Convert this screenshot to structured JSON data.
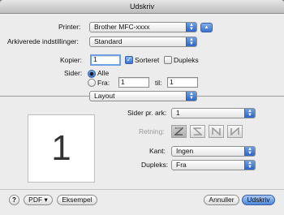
{
  "window": {
    "title": "Udskriv"
  },
  "printer": {
    "label": "Printer:",
    "value": "Brother MFC-xxxx"
  },
  "presets": {
    "label": "Arkiverede indstillinger:",
    "value": "Standard"
  },
  "copies": {
    "label": "Kopier:",
    "value": "1",
    "collated_label": "Sorteret",
    "collated_checked": true,
    "duplex_label": "Dupleks",
    "duplex_checked": false
  },
  "pages": {
    "label": "Sider:",
    "all_label": "Alle",
    "from_label": "Fra:",
    "from_value": "1",
    "to_label": "til:",
    "to_value": "1",
    "selected": "all"
  },
  "panel": {
    "value": "Layout"
  },
  "layout": {
    "preview_page": "1",
    "pages_per_sheet_label": "Sider pr. ark:",
    "pages_per_sheet_value": "1",
    "direction_label": "Retning:",
    "direction_icons": [
      "z-order-icon",
      "s-order-icon",
      "reverse-n-order-icon",
      "n-order-icon"
    ],
    "border_label": "Kant:",
    "border_value": "Ingen",
    "duplex_label": "Dupleks:",
    "duplex_value": "Fra"
  },
  "footer": {
    "help": "?",
    "pdf_label": "PDF ▾",
    "preview_label": "Eksempel",
    "cancel_label": "Annuller",
    "print_label": "Udskriv"
  },
  "colors": {
    "accent": "#3b73d1",
    "window_bg": "#ececec"
  }
}
